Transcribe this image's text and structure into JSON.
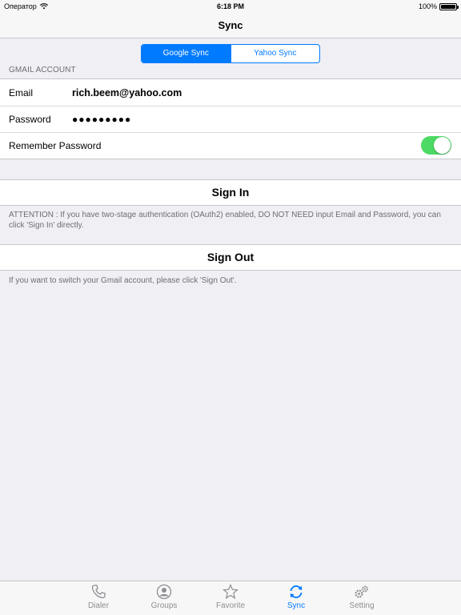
{
  "status_bar": {
    "carrier": "Оператор",
    "time": "6:18 PM",
    "battery": "100%"
  },
  "nav": {
    "title": "Sync"
  },
  "segmented": {
    "options": [
      "Google Sync",
      "Yahoo Sync"
    ],
    "selected": "Google Sync"
  },
  "gmail_section": {
    "header": "GMAIL ACCOUNT",
    "email_label": "Email",
    "email_value": "rich.beem@yahoo.com",
    "password_label": "Password",
    "password_value": "●●●●●●●●●",
    "remember_label": "Remember Password",
    "remember_on": true
  },
  "sign_in": {
    "label": "Sign In",
    "note": "ATTENTION : If you have two-stage authentication (OAuth2) enabled, DO NOT NEED input Email and Password, you can click 'Sign In' directly."
  },
  "sign_out": {
    "label": "Sign Out",
    "note": "If you want to switch your Gmail account, please click 'Sign Out'."
  },
  "tabs": [
    {
      "label": "Dialer",
      "icon": "phone-icon"
    },
    {
      "label": "Groups",
      "icon": "person-icon"
    },
    {
      "label": "Favorite",
      "icon": "star-icon"
    },
    {
      "label": "Sync",
      "icon": "sync-icon",
      "active": true
    },
    {
      "label": "Setting",
      "icon": "gears-icon"
    }
  ],
  "colors": {
    "accent": "#007aff",
    "toggle_on": "#4cd964",
    "background": "#efeff4"
  }
}
